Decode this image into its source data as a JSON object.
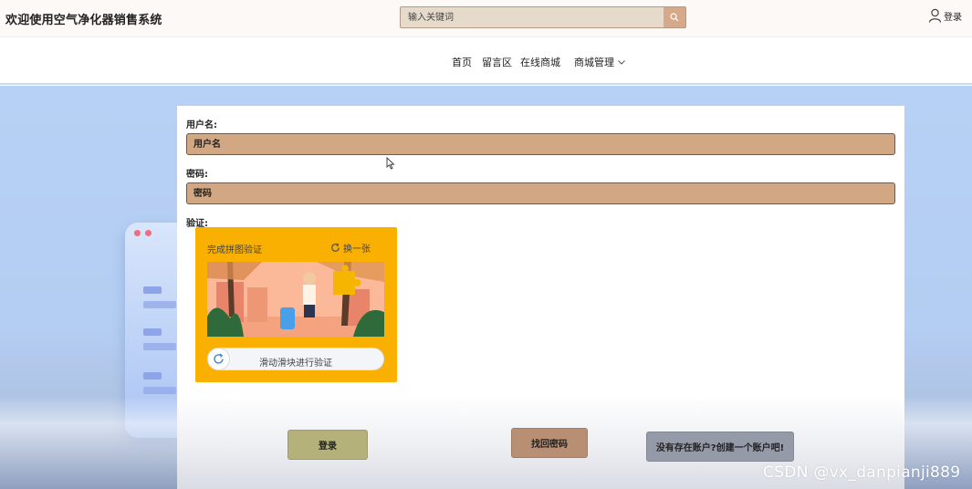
{
  "header": {
    "site_title": "欢迎使用空气净化器销售系统",
    "search_placeholder": "输入关键词",
    "search_icon": "search-icon",
    "login_label": "登录",
    "login_icon": "user-icon"
  },
  "nav": {
    "items": [
      {
        "label": "首页"
      },
      {
        "label": "留言区"
      },
      {
        "label": "在线商城"
      },
      {
        "label": "商城管理",
        "has_dropdown": true
      }
    ]
  },
  "form": {
    "username_label": "用户名:",
    "username_placeholder": "用户名",
    "password_label": "密码:",
    "password_placeholder": "密码",
    "captcha_label": "验证:"
  },
  "captcha": {
    "title": "完成拼图验证",
    "refresh_label": "换一张",
    "slider_text": "滑动滑块进行验证"
  },
  "buttons": {
    "login": "登录",
    "find_password": "找回密码",
    "register": "没有存在账户?创建一个账户吧!"
  },
  "watermark": "CSDN @vx_danpianji889",
  "colors": {
    "input_fill": "#d2a884",
    "captcha_bg": "#f9b000",
    "login_button": "#b5b17a",
    "find_button": "#b98f74",
    "register_button": "#959aa8",
    "background": "#b7d0f5"
  }
}
